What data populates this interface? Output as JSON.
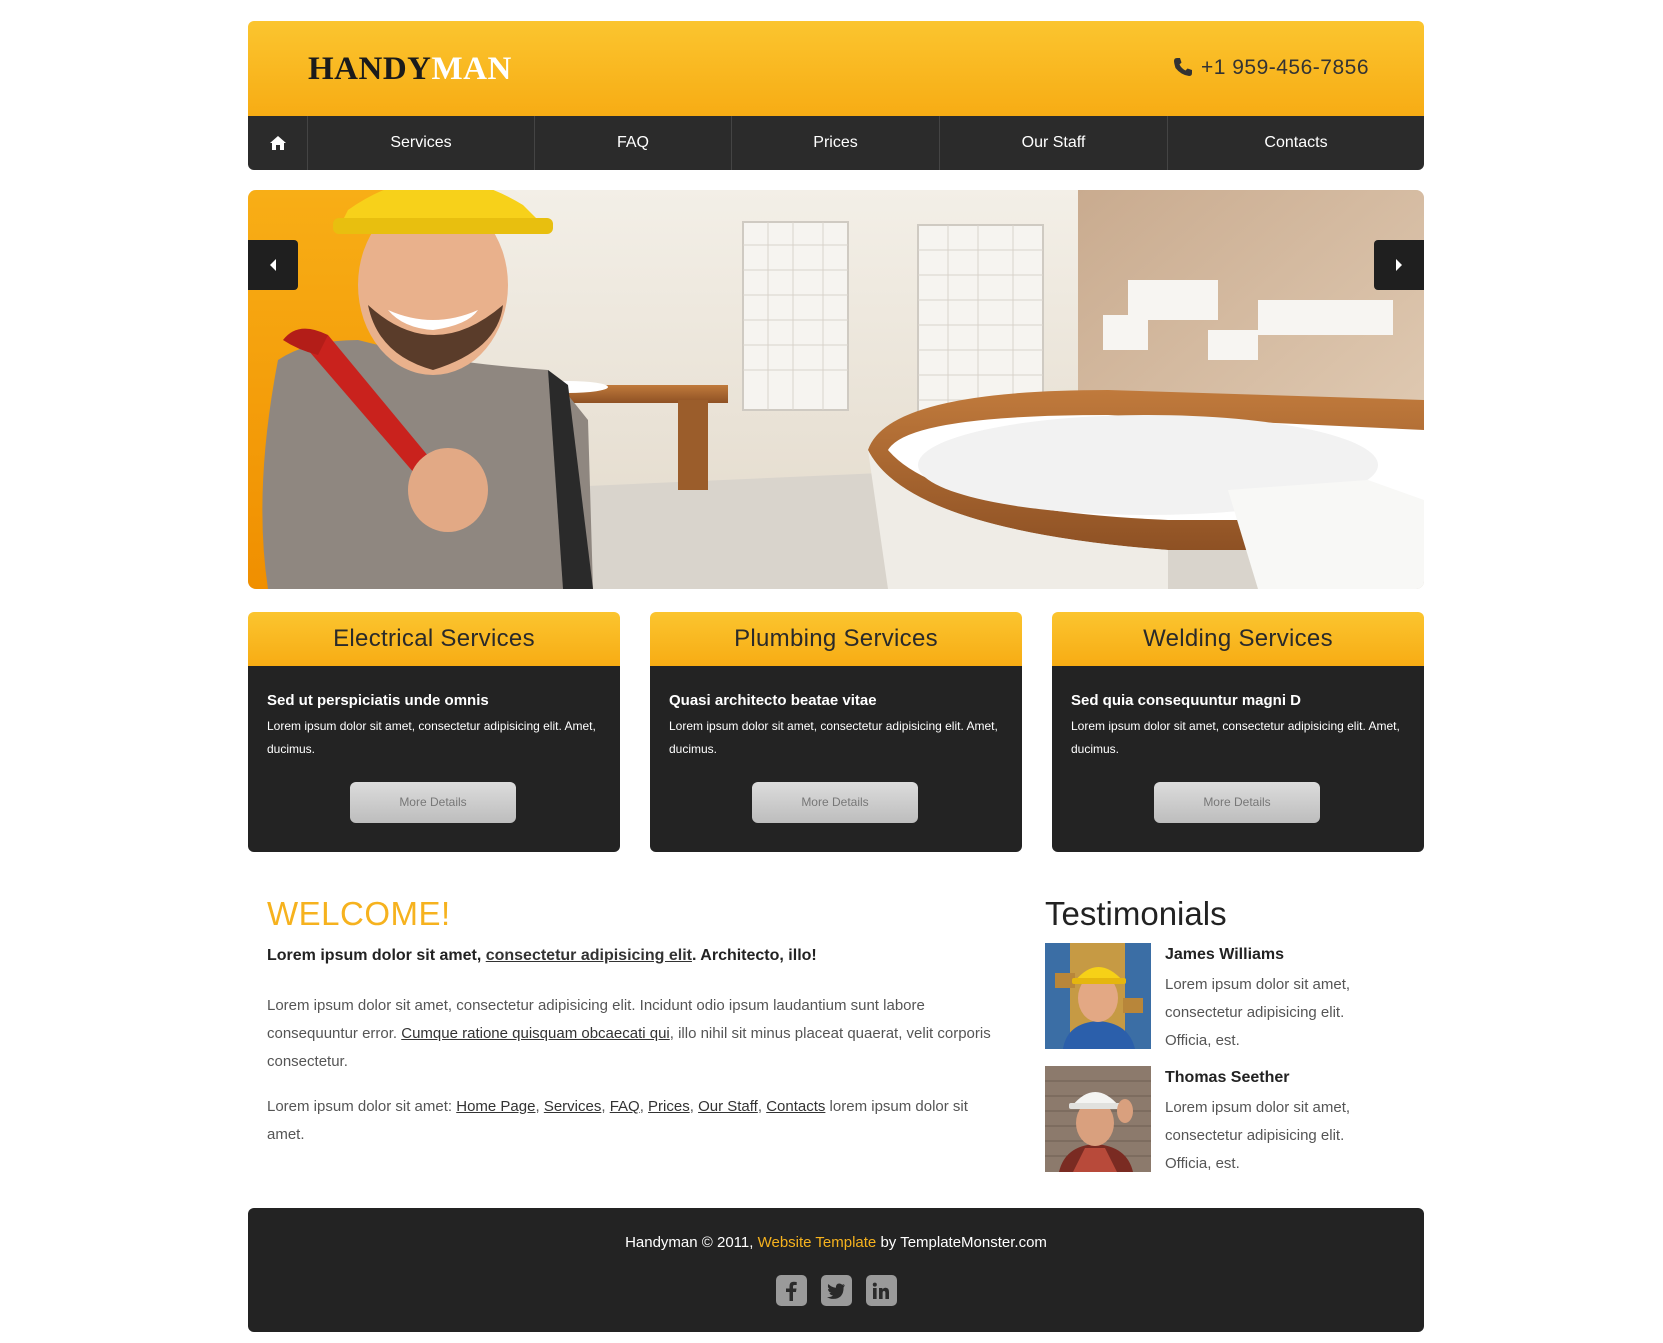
{
  "header": {
    "logo_part1": "HANDY",
    "logo_part2": "MAN",
    "phone": "+1 959-456-7856"
  },
  "nav": {
    "items": [
      "Services",
      "FAQ",
      "Prices",
      "Our Staff",
      "Contacts"
    ]
  },
  "services": [
    {
      "title": "Electrical Services",
      "subtitle": "Sed ut perspiciatis unde omnis",
      "text": "Lorem ipsum dolor sit amet, consectetur adipisicing elit. Amet, ducimus.",
      "button": "More Details"
    },
    {
      "title": "Plumbing Services",
      "subtitle": "Quasi architecto beatae vitae",
      "text": "Lorem ipsum dolor sit amet, consectetur adipisicing elit. Amet, ducimus.",
      "button": "More Details"
    },
    {
      "title": "Welding Services",
      "subtitle": "Sed quia consequuntur magni D",
      "text": "Lorem ipsum dolor sit amet, consectetur adipisicing elit. Amet, ducimus.",
      "button": "More Details"
    }
  ],
  "welcome": {
    "title": "WELCOME!",
    "lead_pre": "Lorem ipsum dolor sit amet, ",
    "lead_link": "consectetur adipisicing elit",
    "lead_post": ". Architecto, illo!",
    "p1_pre": "Lorem ipsum dolor sit amet, consectetur adipisicing elit. Incidunt odio ipsum laudantium sunt labore consequuntur error. ",
    "p1_link": "Cumque ratione quisquam obcaecati qui",
    "p1_post": ", illo nihil sit minus placeat quaerat, velit corporis consectetur.",
    "p2_pre": "Lorem ipsum dolor sit amet: ",
    "p2_links": [
      "Home Page",
      "Services",
      "FAQ",
      "Prices",
      "Our Staff",
      "Contacts"
    ],
    "p2_post": " lorem ipsum dolor sit amet."
  },
  "testimonials": {
    "title": "Testimonials",
    "items": [
      {
        "name": "James Williams",
        "text": "Lorem ipsum dolor sit amet, consectetur adipisicing elit. Officia, est."
      },
      {
        "name": "Thomas Seether",
        "text": "Lorem ipsum dolor sit amet, consectetur adipisicing elit. Officia, est."
      }
    ]
  },
  "footer": {
    "pre": "Handyman © 2011, ",
    "link": "Website Template",
    "post": " by TemplateMonster.com",
    "social": [
      "f",
      "t",
      "in"
    ]
  },
  "colors": {
    "accent": "#f6b21e",
    "dark": "#232323",
    "nav": "#2b2b2b"
  }
}
